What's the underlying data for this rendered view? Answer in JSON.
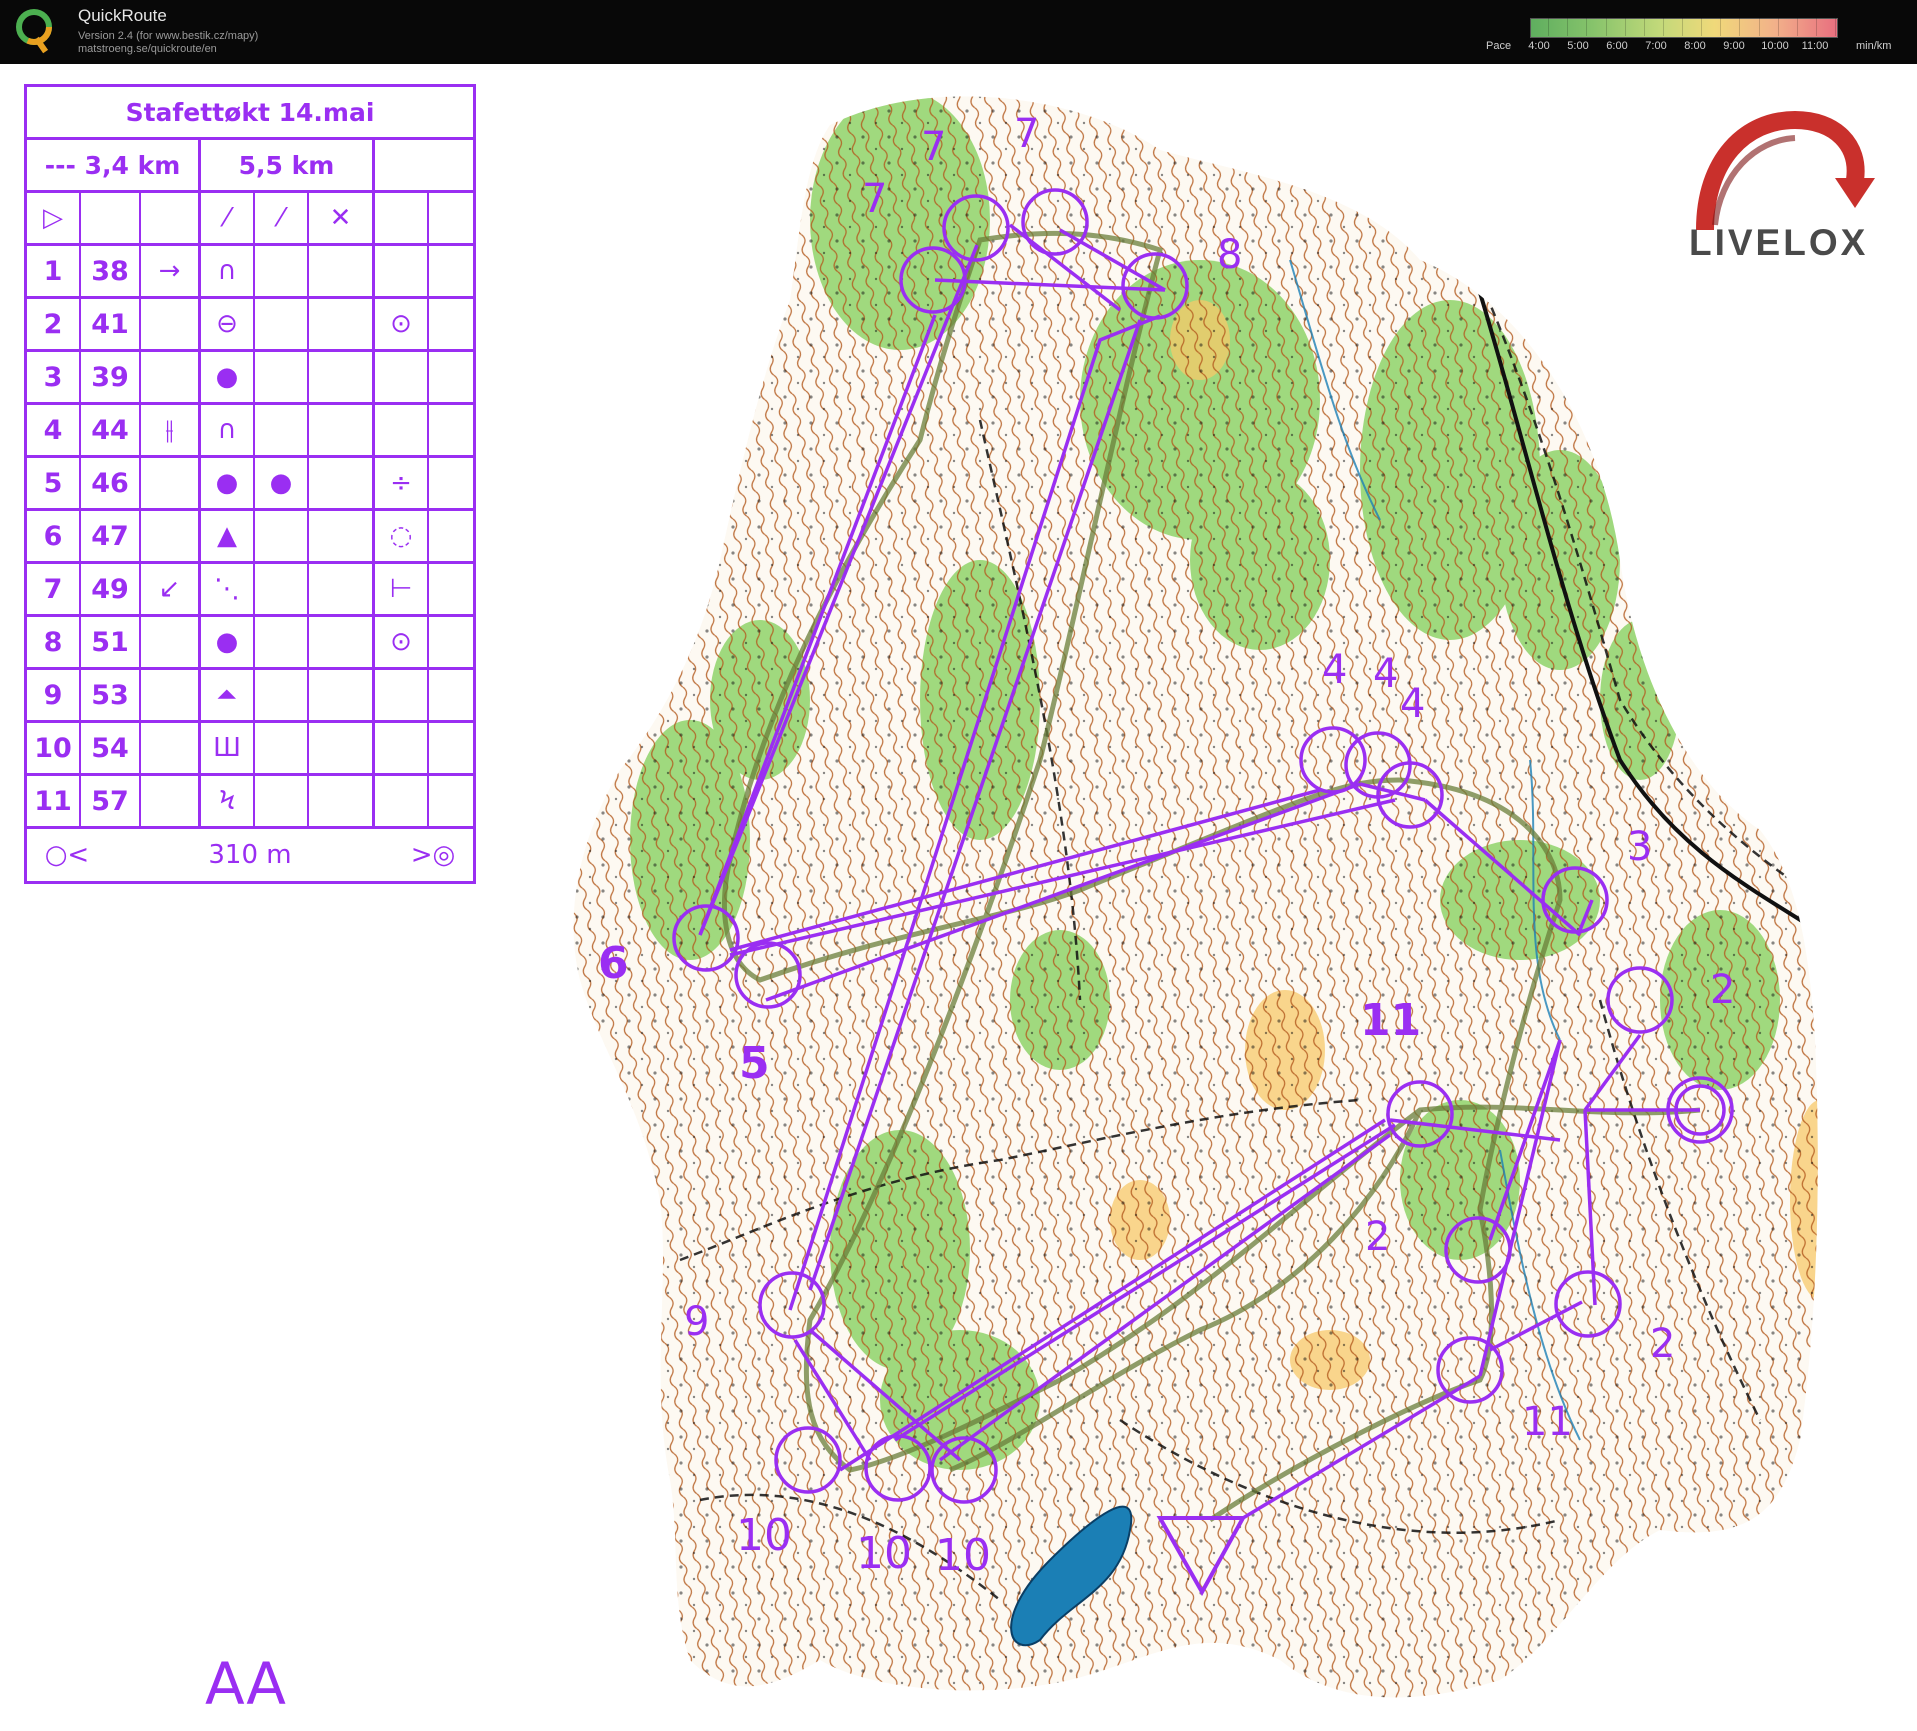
{
  "app": {
    "title": "QuickRoute",
    "subtitle_line1": "Version 2.4  (for www.bestik.cz/mapy)",
    "subtitle_line2": "matstroeng.se/quickroute/en"
  },
  "pace_scale": {
    "label": "Pace",
    "ticks": [
      "4:00",
      "5:00",
      "6:00",
      "7:00",
      "8:00",
      "9:00",
      "10:00",
      "11:00"
    ],
    "unit": "min/km"
  },
  "description_sheet": {
    "title": "Stafettøkt 14.mai",
    "short_course": "--- 3,4 km",
    "long_course": "5,5 km",
    "controls": [
      {
        "num": "1",
        "code": "38"
      },
      {
        "num": "2",
        "code": "41"
      },
      {
        "num": "3",
        "code": "39"
      },
      {
        "num": "4",
        "code": "44"
      },
      {
        "num": "5",
        "code": "46"
      },
      {
        "num": "6",
        "code": "47"
      },
      {
        "num": "7",
        "code": "49"
      },
      {
        "num": "8",
        "code": "51"
      },
      {
        "num": "9",
        "code": "53"
      },
      {
        "num": "10",
        "code": "54"
      },
      {
        "num": "11",
        "code": "57"
      }
    ],
    "finish_distance": "310 m"
  },
  "map_labels": {
    "course_code": "AA",
    "brand": "LIVELOX"
  },
  "course_numbers": [
    "7",
    "7",
    "7",
    "8",
    "4",
    "4",
    "4",
    "3",
    "2",
    "2",
    "2",
    "11",
    "11",
    "6",
    "5",
    "9",
    "10",
    "10",
    "10",
    "2"
  ],
  "colors": {
    "course": "#9a2ef2",
    "topbar": "#080808",
    "forest_green": "#6cc24a",
    "open_yellow": "#f7c86a",
    "contour_brown": "#b35a1f",
    "water_blue": "#1b7fb5"
  }
}
